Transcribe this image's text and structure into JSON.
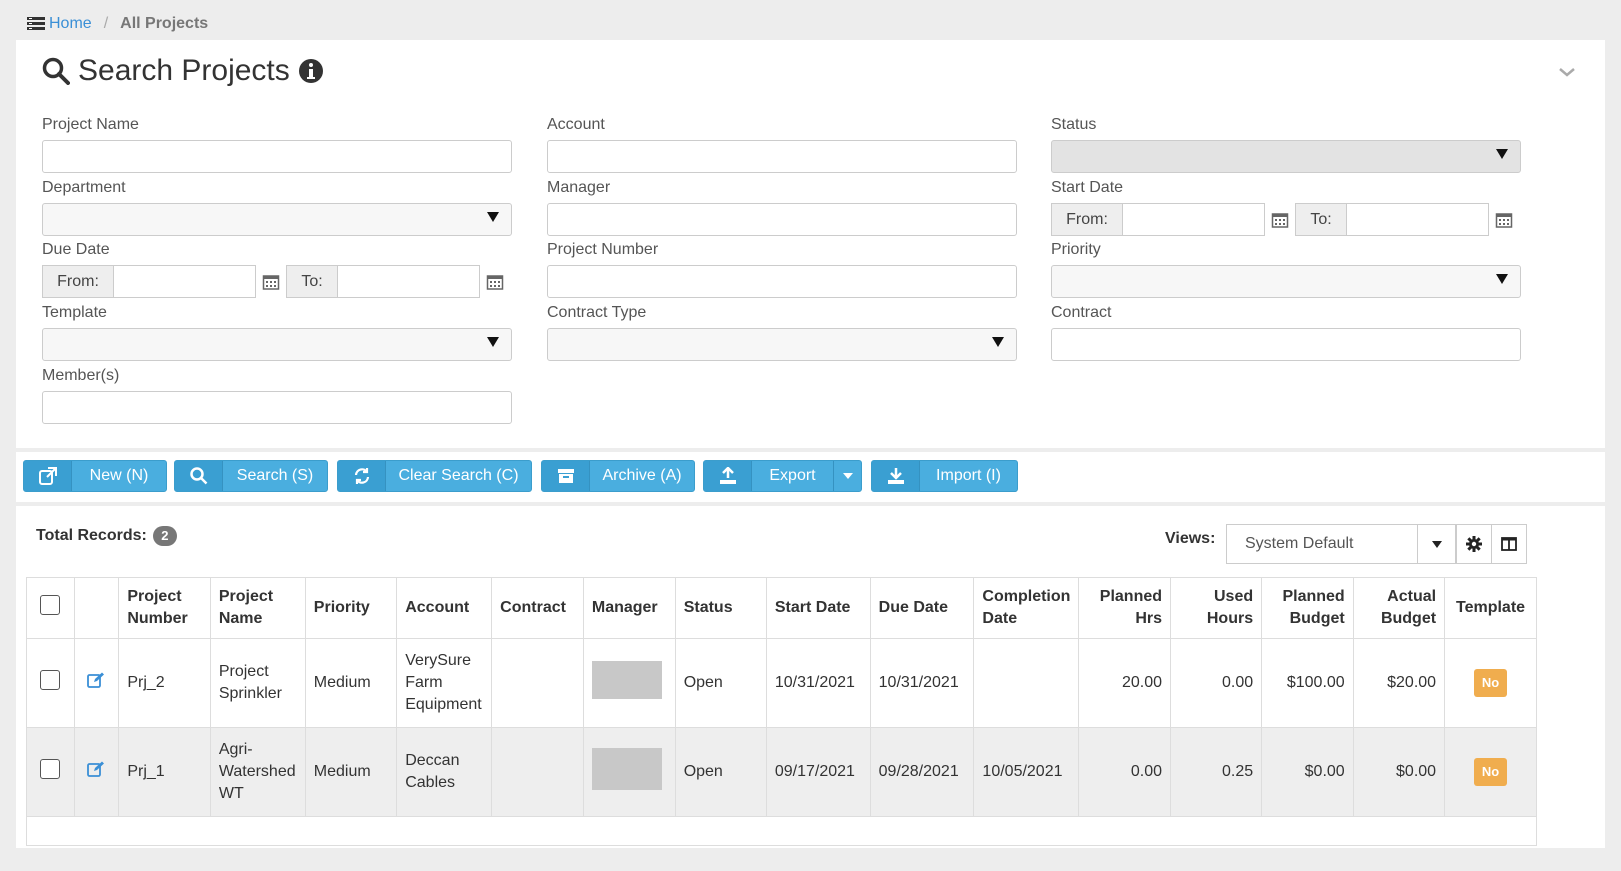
{
  "breadcrumb": {
    "home": "Home",
    "separator": "/",
    "current": "All Projects"
  },
  "search": {
    "title": "Search Projects",
    "fields": {
      "project_name": {
        "label": "Project Name",
        "value": ""
      },
      "account": {
        "label": "Account",
        "value": ""
      },
      "status": {
        "label": "Status",
        "value": ""
      },
      "department": {
        "label": "Department",
        "value": ""
      },
      "manager": {
        "label": "Manager",
        "value": ""
      },
      "start_date": {
        "label": "Start Date",
        "from": "From:",
        "to": "To:"
      },
      "due_date": {
        "label": "Due Date",
        "from": "From:",
        "to": "To:"
      },
      "project_number": {
        "label": "Project Number",
        "value": ""
      },
      "priority": {
        "label": "Priority",
        "value": ""
      },
      "template": {
        "label": "Template",
        "value": ""
      },
      "contract_type": {
        "label": "Contract Type",
        "value": ""
      },
      "contract": {
        "label": "Contract",
        "value": ""
      },
      "members": {
        "label": "Member(s)",
        "value": ""
      }
    }
  },
  "actions": {
    "new": "New (N)",
    "search": "Search (S)",
    "clear": "Clear Search (C)",
    "archive": "Archive (A)",
    "export": "Export",
    "import": "Import (I)"
  },
  "results": {
    "total_label": "Total Records:",
    "total_count": "2",
    "views_label": "Views:",
    "views_value": "System Default",
    "columns": {
      "project_number": [
        "Project",
        "Number"
      ],
      "project_name": [
        "Project",
        "Name"
      ],
      "priority": "Priority",
      "account": "Account",
      "contract": "Contract",
      "manager": "Manager",
      "status": "Status",
      "start_date": "Start Date",
      "due_date": "Due Date",
      "completion_date": [
        "Completion",
        "Date"
      ],
      "planned_hrs": [
        "Planned",
        "Hrs"
      ],
      "used_hours": [
        "Used",
        "Hours"
      ],
      "planned_budget": [
        "Planned",
        "Budget"
      ],
      "actual_budget": [
        "Actual",
        "Budget"
      ],
      "template": "Template"
    },
    "rows": [
      {
        "number": "Prj_2",
        "name": [
          "Project",
          "Sprinkler"
        ],
        "priority": "Medium",
        "account": [
          "VerySure",
          "Farm",
          "Equipment"
        ],
        "contract": "",
        "status": "Open",
        "start": "10/31/2021",
        "due": "10/31/2021",
        "completion": "",
        "planned_hrs": "20.00",
        "used_hours": "0.00",
        "planned_budget": "$100.00",
        "actual_budget": "$20.00",
        "template": "No"
      },
      {
        "number": "Prj_1",
        "name": [
          "Agri-",
          "Watershed",
          "WT"
        ],
        "priority": "Medium",
        "account": [
          "Deccan",
          "Cables"
        ],
        "contract": "",
        "status": "Open",
        "start": "09/17/2021",
        "due": "09/28/2021",
        "completion": "10/05/2021",
        "planned_hrs": "0.00",
        "used_hours": "0.25",
        "planned_budget": "$0.00",
        "actual_budget": "$0.00",
        "template": "No"
      }
    ]
  },
  "colors": {
    "accent": "#4aaedf",
    "badge": "#f0ad4e",
    "link": "#3a8fd6"
  }
}
